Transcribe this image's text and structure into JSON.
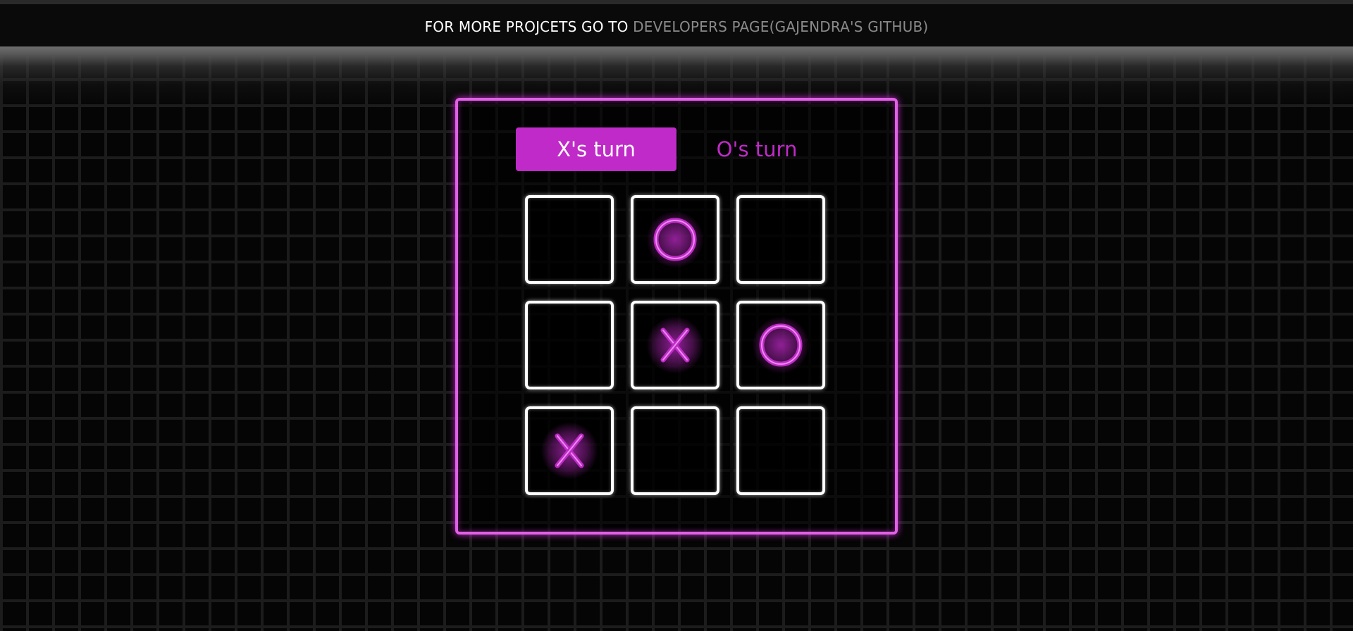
{
  "header": {
    "prefix": "FOR MORE PROJCETS GO TO",
    "link_text": "DEVELOPERS PAGE(GAJENDRA'S GITHUB)"
  },
  "turns": {
    "x_label": "X's turn",
    "o_label": "O's turn",
    "active": "X"
  },
  "colors": {
    "accent": "#c02ac8",
    "frame": "#e060e6",
    "cell_border": "#ffffff",
    "link": "#8a8a8a"
  },
  "board": {
    "cells": [
      "",
      "O",
      "",
      "",
      "X",
      "O",
      "X",
      "",
      ""
    ]
  }
}
